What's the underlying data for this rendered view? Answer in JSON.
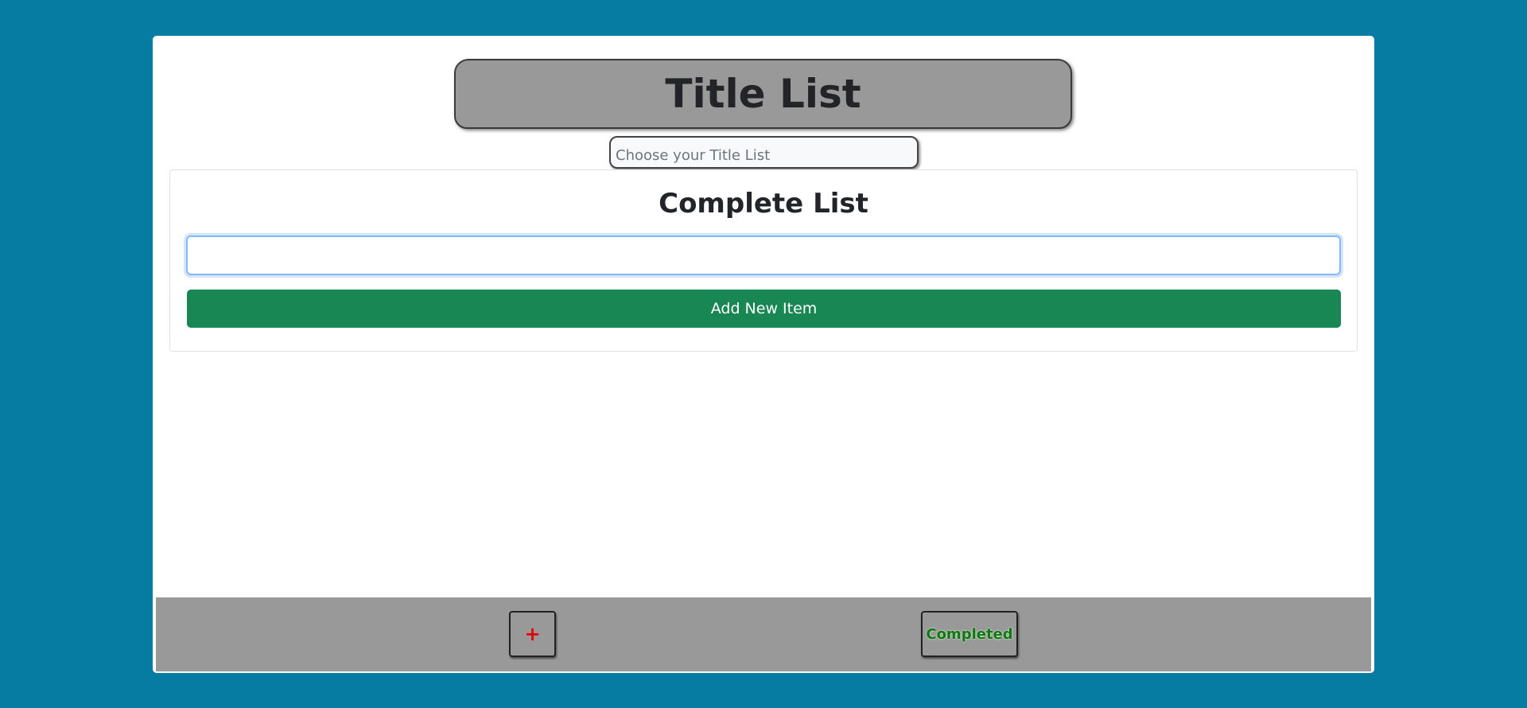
{
  "header": {
    "title": "Title List",
    "select_placeholder": "Choose your Title List"
  },
  "list_panel": {
    "heading": "Complete List",
    "item_input_value": "",
    "add_button_label": "Add New Item"
  },
  "footer": {
    "add_list_label": "+",
    "completed_label": "Completed"
  },
  "colors": {
    "background": "#077ca3",
    "banner": "#999999",
    "add_button": "#198754",
    "plus_icon": "#e00000",
    "completed_text": "#0a7a0a"
  }
}
